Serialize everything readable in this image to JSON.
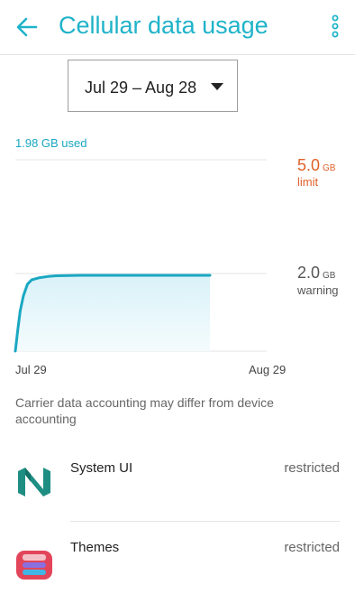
{
  "appbar": {
    "title": "Cellular data usage",
    "back_icon": "arrow-left-icon",
    "menu_icon": "more-vertical-icon",
    "accent_color": "#1fb3c9"
  },
  "cycle": {
    "selected": "Jul 29 – Aug 28",
    "caret_icon": "caret-down-icon"
  },
  "usage": {
    "used_label": "1.98 GB used",
    "limit_value": "5.0",
    "limit_unit": "GB",
    "limit_caption": "limit",
    "limit_color": "#e0602a",
    "warning_value": "2.0",
    "warning_unit": "GB",
    "warning_caption": "warning",
    "line_color": "#1aa7c2"
  },
  "chart_data": {
    "type": "area",
    "x_start_label": "Jul 29",
    "x_end_label": "Aug 29",
    "x": [
      0,
      0.3,
      0.6,
      1,
      1.5,
      2,
      3,
      4,
      5,
      8,
      11,
      15,
      20,
      24
    ],
    "y": [
      0,
      0.55,
      1.05,
      1.45,
      1.75,
      1.86,
      1.92,
      1.95,
      1.97,
      1.98,
      1.98,
      1.98,
      1.98,
      1.98
    ],
    "x_range_days": [
      0,
      31
    ],
    "ylim": [
      0,
      5.0
    ],
    "limit_gb": 5.0,
    "warning_gb": 2.0
  },
  "note": "Carrier data accounting may differ from device accounting",
  "apps": [
    {
      "name": "System UI",
      "status": "restricted",
      "icon": "android-n-icon"
    },
    {
      "name": "Themes",
      "status": "restricted",
      "icon": "themes-app-icon"
    }
  ]
}
